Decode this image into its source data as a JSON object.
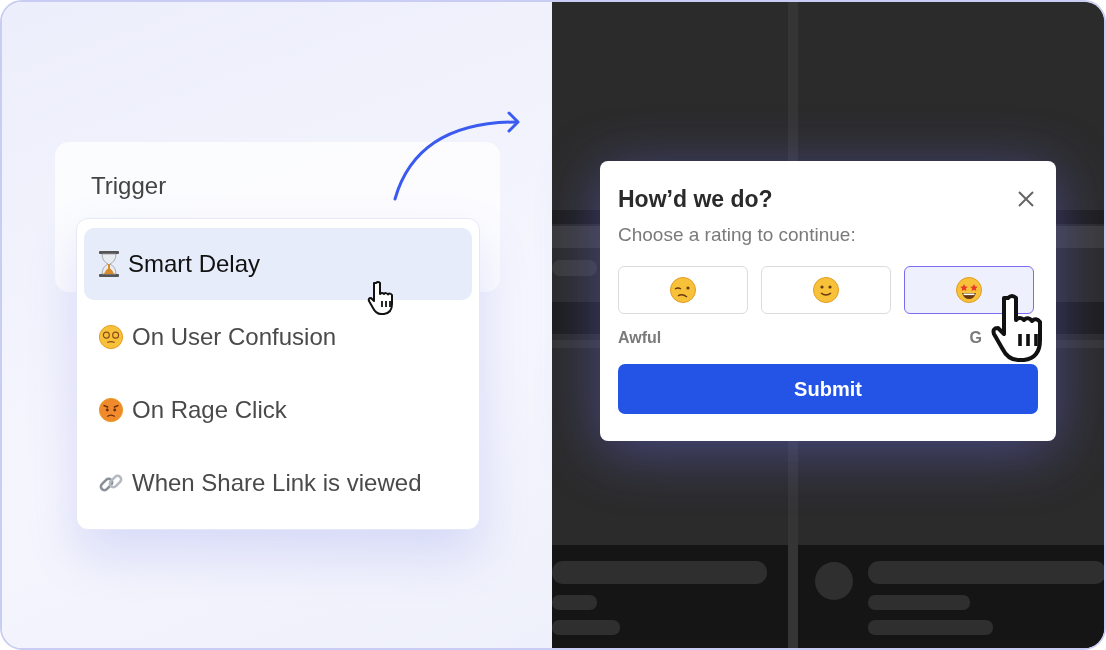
{
  "trigger": {
    "label": "Trigger",
    "options": [
      {
        "kind": "hourglass",
        "label": "Smart Delay",
        "selected": true
      },
      {
        "kind": "dizzy",
        "label": "On User Confusion",
        "selected": false
      },
      {
        "kind": "angry",
        "label": "On Rage Click",
        "selected": false
      },
      {
        "kind": "link",
        "label": "When Share Link is viewed",
        "selected": false
      }
    ]
  },
  "survey": {
    "title": "How’d we do?",
    "subtitle": "Choose a rating to continue:",
    "ratings": [
      {
        "kind": "woozy",
        "selected": false
      },
      {
        "kind": "smile",
        "selected": false
      },
      {
        "kind": "starstruck",
        "selected": true
      }
    ],
    "low_label": "Awful",
    "high_label": "G",
    "submit": "Submit"
  }
}
